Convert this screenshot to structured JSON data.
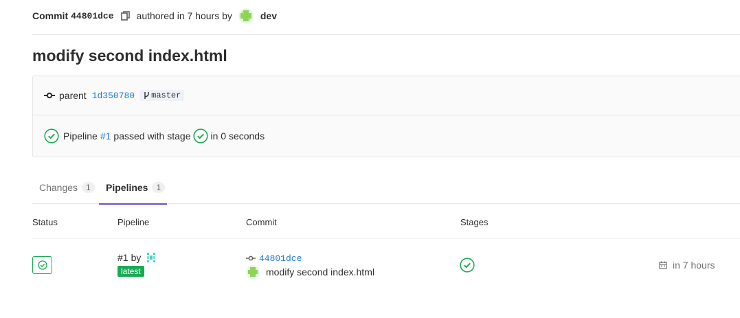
{
  "header": {
    "commit_word": "Commit",
    "sha": "44801dce",
    "authored_text": "authored in 7 hours by",
    "author": "dev"
  },
  "title": "modify second index.html",
  "info": {
    "parent_label": "parent",
    "parent_sha": "1d350780",
    "branch": "master",
    "pipeline_prefix": "Pipeline",
    "pipeline_id": "#1",
    "pipeline_mid": "passed with stage",
    "pipeline_suffix": "in 0 seconds"
  },
  "tabs": [
    {
      "label": "Changes",
      "count": "1"
    },
    {
      "label": "Pipelines",
      "count": "1"
    }
  ],
  "table": {
    "headers": [
      "Status",
      "Pipeline",
      "Commit",
      "Stages"
    ],
    "row": {
      "pipeline_id": "#1",
      "by": "by",
      "badge": "latest",
      "commit_sha": "44801dce",
      "commit_message": "modify second index.html",
      "time": "in 7 hours"
    }
  },
  "colors": {
    "success": "#1aaa55",
    "link": "#1f78d1",
    "active_tab": "#6b4fbb"
  }
}
